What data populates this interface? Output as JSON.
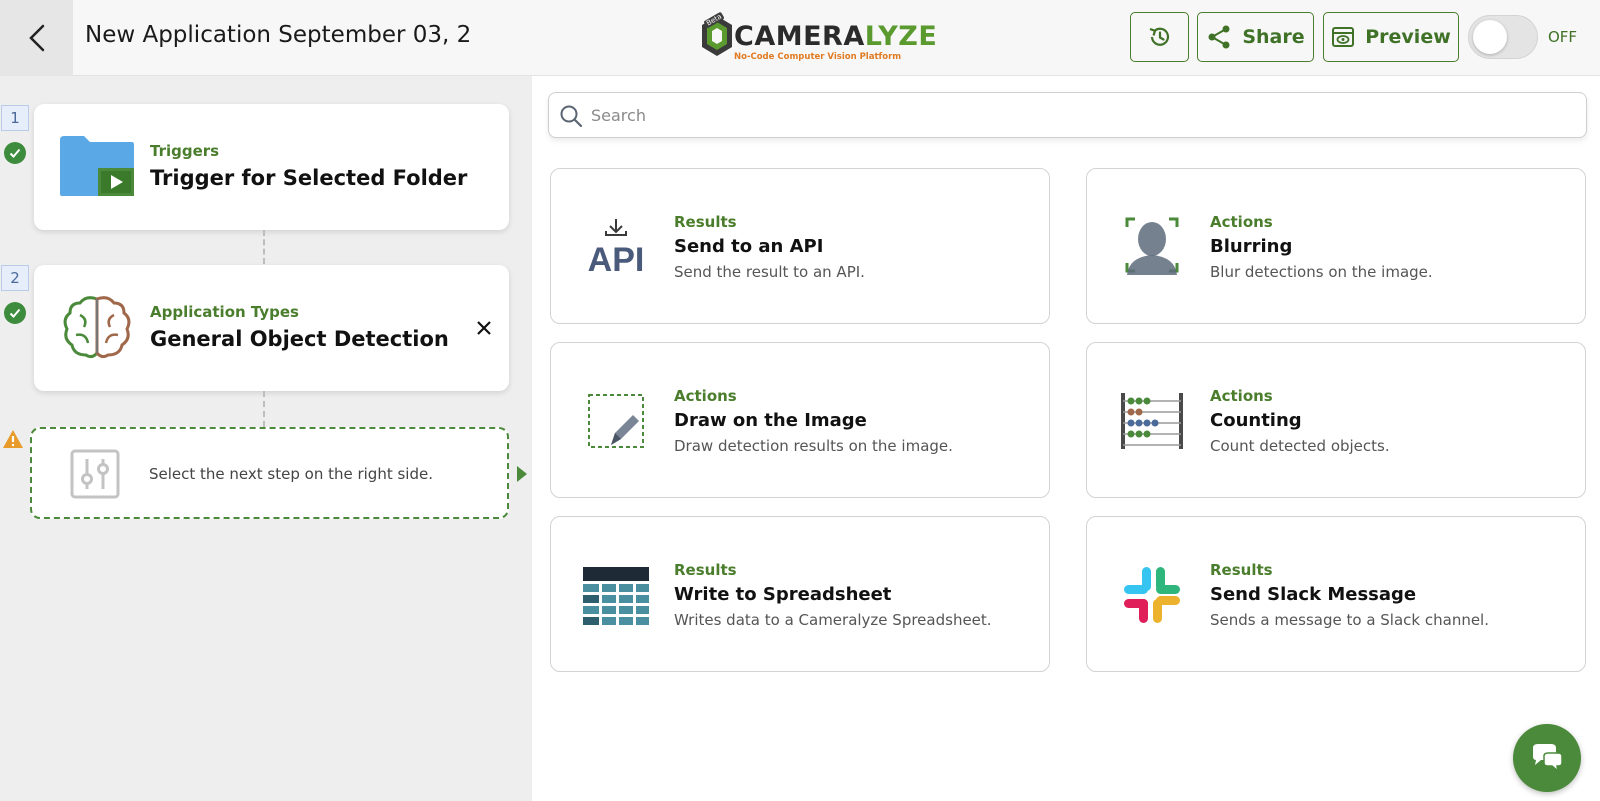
{
  "header": {
    "title": "New Application September 03, 2",
    "logo_text_a": "CAMERA",
    "logo_text_b": "LYZE",
    "logo_tagline": "No-Code Computer Vision Platform",
    "logo_badge": "Beta",
    "share_label": "Share",
    "preview_label": "Preview",
    "toggle_label": "OFF"
  },
  "workflow": {
    "steps": [
      {
        "number": "1",
        "category": "Triggers",
        "title": "Trigger for Selected Folder",
        "icon": "folder-play-icon"
      },
      {
        "number": "2",
        "category": "Application Types",
        "title": "General Object Detection",
        "icon": "brain-icon"
      }
    ],
    "next_step_text": "Select the next step on the right side."
  },
  "search": {
    "placeholder": "Search",
    "value": ""
  },
  "options": [
    {
      "category": "Results",
      "title": "Send to an API",
      "description": "Send the result to an API.",
      "icon_text": "API",
      "icon": "api-download-icon"
    },
    {
      "category": "Actions",
      "title": "Blurring",
      "description": "Blur detections on the image.",
      "icon": "blur-person-icon"
    },
    {
      "category": "Actions",
      "title": "Draw on the Image",
      "description": "Draw detection results on the image.",
      "icon": "draw-pencil-icon"
    },
    {
      "category": "Actions",
      "title": "Counting",
      "description": "Count detected objects.",
      "icon": "abacus-icon"
    },
    {
      "category": "Results",
      "title": "Write to Spreadsheet",
      "description": "Writes data to a Cameralyze Spreadsheet.",
      "icon": "spreadsheet-icon"
    },
    {
      "category": "Results",
      "title": "Send Slack Message",
      "description": "Sends a message to a Slack channel.",
      "icon": "slack-icon"
    }
  ],
  "colors": {
    "brand_green": "#4a7d2c",
    "accent_orange": "#e07b22",
    "folder_blue": "#5aa9e6",
    "step_badge_bg": "#e6eefb"
  }
}
